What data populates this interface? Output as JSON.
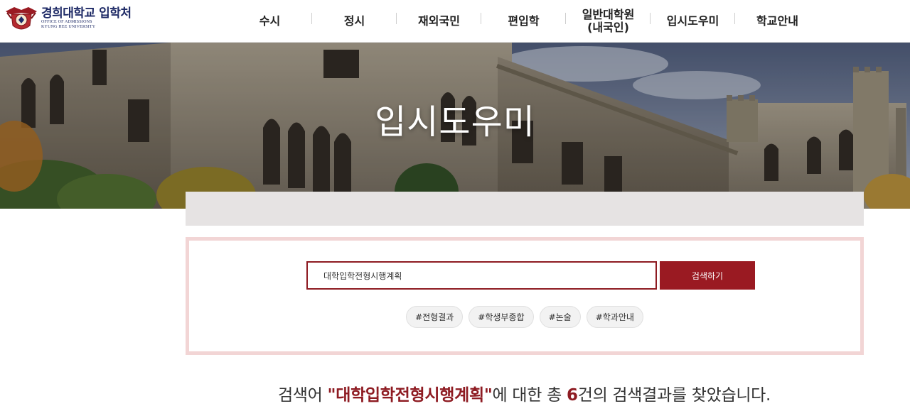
{
  "header": {
    "logo": {
      "title": "경희대학교 입학처",
      "sub1": "OFFICE OF ADMISSIONS",
      "sub2": "KYUNG HEE UNIVERSITY"
    },
    "nav": [
      {
        "label": "수시"
      },
      {
        "label": "정시"
      },
      {
        "label": "재외국민"
      },
      {
        "label": "편입학"
      },
      {
        "label": "일반대학원\n(내국인)"
      },
      {
        "label": "입시도우미"
      },
      {
        "label": "학교안내"
      }
    ]
  },
  "hero": {
    "title": "입시도우미"
  },
  "search": {
    "query": "대학입학전형시행계획",
    "button_label": "검색하기",
    "tags": [
      "#전형결과",
      "#학생부종합",
      "#논술",
      "#학과안내"
    ]
  },
  "result": {
    "prefix": "검색어 ",
    "keyword": "\"대학입학전형시행계획\"",
    "middle": "에 대한 총 ",
    "count": "6",
    "suffix": "건의 검색결과를 찾았습니다."
  },
  "colors": {
    "brand_red": "#9a1a22",
    "brand_navy": "#1e2a66",
    "box_border": "#f2d5d5"
  }
}
